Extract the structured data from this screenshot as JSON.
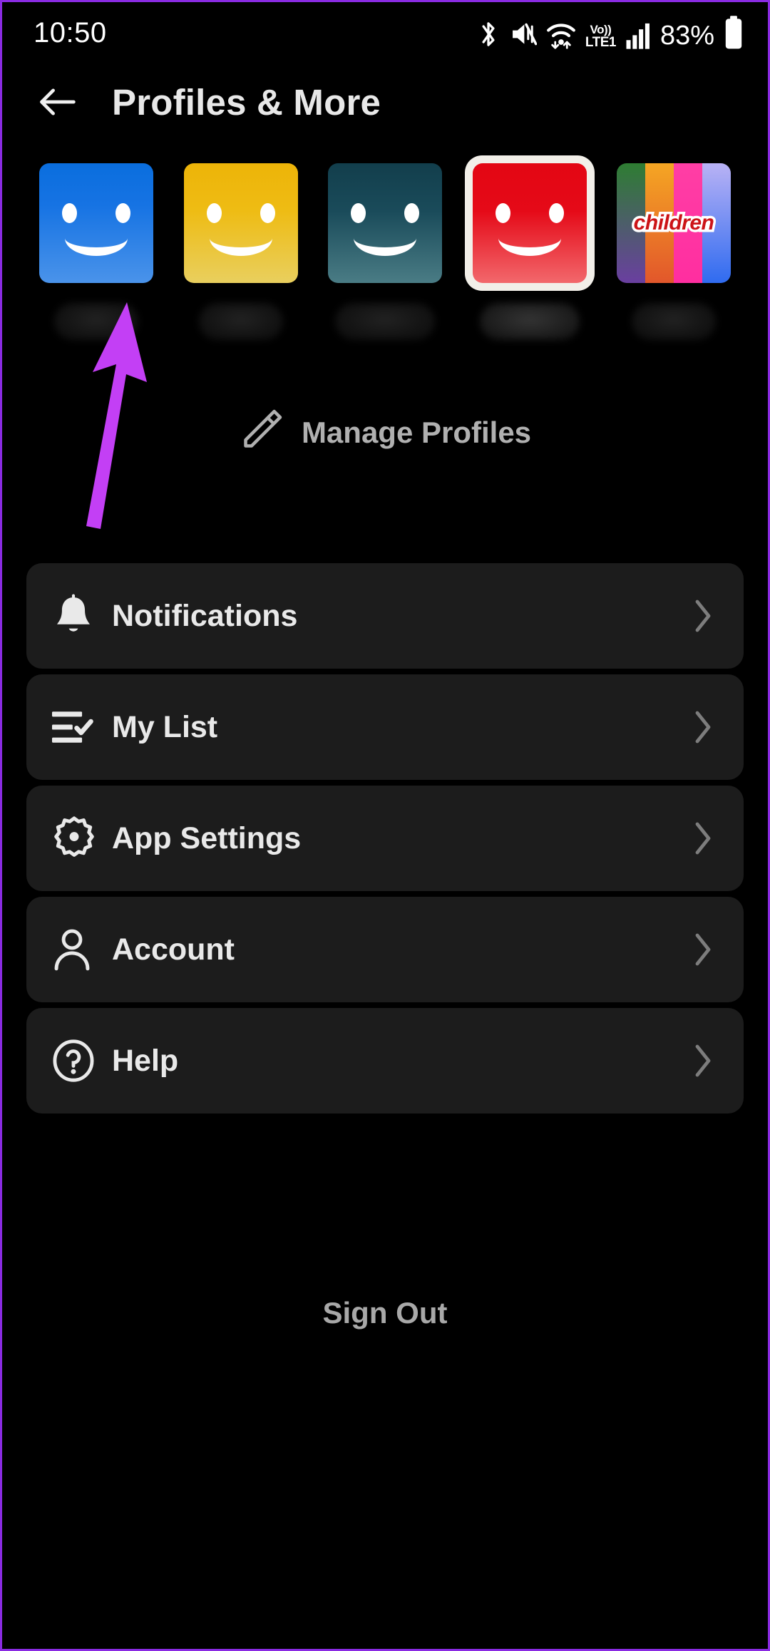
{
  "status_bar": {
    "time": "10:50",
    "battery_percent": "83%",
    "volte_top": "Vo))",
    "volte_bottom": "LTE1",
    "icons": [
      "bluetooth-icon",
      "mute-icon",
      "wifi-icon",
      "volte-icon",
      "signal-icon",
      "battery-icon"
    ]
  },
  "header": {
    "back_icon": "back-arrow-icon",
    "title": "Profiles & More"
  },
  "profiles": {
    "items": [
      {
        "id": "profile-1",
        "type": "smiley",
        "color": "#1673e3",
        "name": "",
        "selected": false
      },
      {
        "id": "profile-2",
        "type": "smiley",
        "color": "#eebc14",
        "name": "",
        "selected": false
      },
      {
        "id": "profile-3",
        "type": "smiley",
        "color": "#1a4b5a",
        "name": "",
        "selected": false
      },
      {
        "id": "profile-4",
        "type": "smiley",
        "color": "#e50a18",
        "name": "",
        "selected": true
      },
      {
        "id": "profile-5",
        "type": "kids",
        "color": "#ff2ea0",
        "name": "",
        "label": "children",
        "selected": false
      }
    ]
  },
  "manage_profiles": {
    "icon": "pencil-icon",
    "label": "Manage Profiles"
  },
  "menu": {
    "items": [
      {
        "icon": "bell-icon",
        "label": "Notifications",
        "chevron": "chevron-right-icon"
      },
      {
        "icon": "list-check-icon",
        "label": "My List",
        "chevron": "chevron-right-icon"
      },
      {
        "icon": "gear-icon",
        "label": "App Settings",
        "chevron": "chevron-right-icon"
      },
      {
        "icon": "person-icon",
        "label": "Account",
        "chevron": "chevron-right-icon"
      },
      {
        "icon": "help-icon",
        "label": "Help",
        "chevron": "chevron-right-icon"
      }
    ]
  },
  "footer": {
    "sign_out_label": "Sign Out"
  },
  "annotation": {
    "arrow_color": "#c33ff5",
    "points_to": "profile-1"
  },
  "theme": {
    "background": "#000000",
    "card": "#1c1c1c",
    "text_primary": "#e9e9e9",
    "text_secondary": "#b0b0b0",
    "frame_border": "#8a2be2"
  }
}
